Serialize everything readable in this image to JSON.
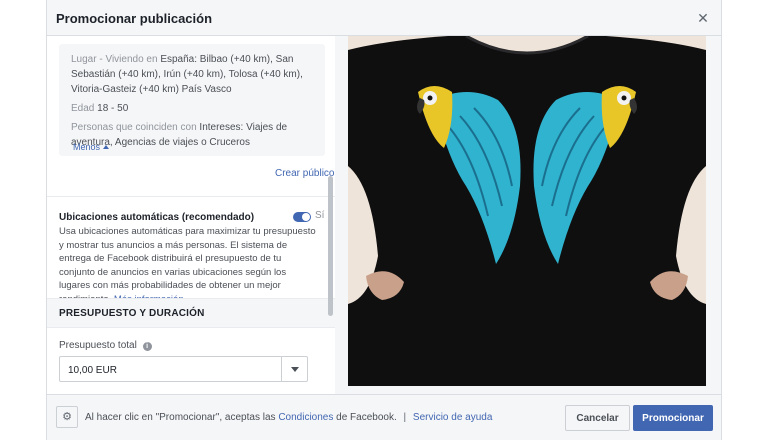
{
  "header": {
    "title": "Promocionar publicación"
  },
  "audience": {
    "location_label": "Lugar - Viviendo en",
    "location_value": "España: Bilbao (+40 km), San Sebastián (+40 km), Irún (+40 km), Tolosa (+40 km), Vitoria-Gasteiz (+40 km) País Vasco",
    "age_label": "Edad",
    "age_value": "18 - 50",
    "interests_label": "Personas que coinciden con",
    "interests_value": "Intereses: Viajes de aventura, Agencias de viajes o Cruceros",
    "less_label": "Menos"
  },
  "create_audience_link": "Crear público",
  "auto_placements": {
    "title": "Ubicaciones automáticas (recomendado)",
    "toggle_state": "Sí",
    "toggle_on": true,
    "description": "Usa ubicaciones automáticas para maximizar tu presupuesto y mostrar tus anuncios a más personas. El sistema de entrega de Facebook distribuirá el presupuesto de tu conjunto de anuncios en varias ubicaciones según los lugares con más probabilidades de obtener un mejor rendimiento.",
    "more_info_link": "Más información."
  },
  "budget_section": {
    "title": "PRESUPUESTO Y DURACIÓN",
    "total_budget_label": "Presupuesto total",
    "total_budget_value": "10,00 EUR"
  },
  "preview": {
    "image": "black-tshirt-parrot-wings-photo"
  },
  "footer": {
    "terms_prefix": "Al hacer clic en \"Promocionar\", aceptas las",
    "terms_link": "Condiciones",
    "terms_suffix": "de Facebook.",
    "separator": "|",
    "help_link": "Servicio de ayuda",
    "cancel_label": "Cancelar",
    "promote_label": "Promocionar"
  },
  "colors": {
    "accent": "#4267b2",
    "background": "#f5f6f7"
  }
}
